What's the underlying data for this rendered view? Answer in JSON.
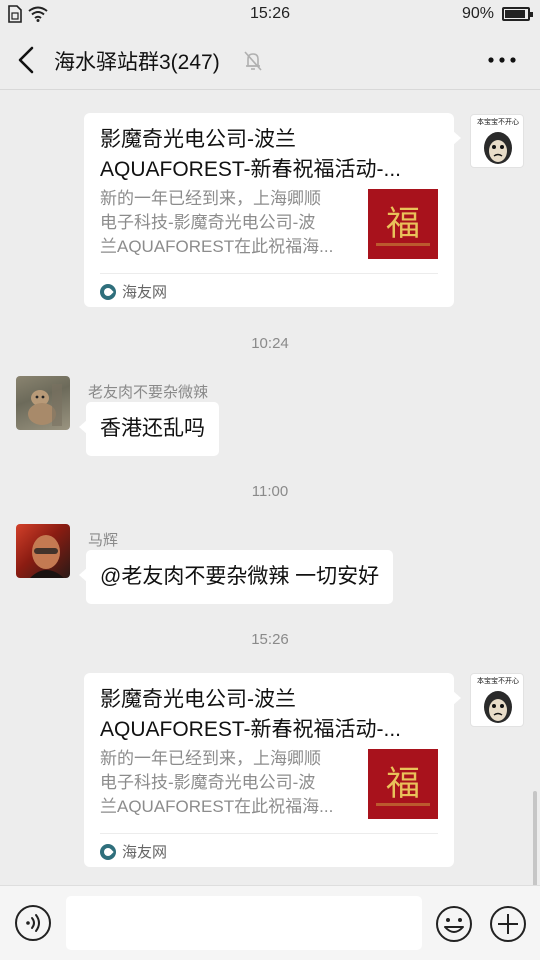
{
  "status_bar": {
    "time": "15:26",
    "battery": "90%"
  },
  "header": {
    "title": "海水驿站群3(247)"
  },
  "messages": {
    "card1": {
      "title": "影魔奇光电公司-波兰\nAQUAFOREST-新春祝福活动-...",
      "desc": "新的一年已经到来，上海卿顺\n电子科技-影魔奇光电公司-波\n兰AQUAFOREST在此祝福海...",
      "source": "海友网",
      "avatar_text": "本宝宝不开心",
      "thumb_text": "福"
    },
    "time1": "10:24",
    "msg1": {
      "sender": "老友肉不要杂微辣",
      "text": "香港还乱吗"
    },
    "time2": "11:00",
    "msg2": {
      "sender": "马辉",
      "text": "@老友肉不要杂微辣  一切安好"
    },
    "time3": "15:26",
    "card2": {
      "title": "影魔奇光电公司-波兰\nAQUAFOREST-新春祝福活动-...",
      "desc": "新的一年已经到来，上海卿顺\n电子科技-影魔奇光电公司-波\n兰AQUAFOREST在此祝福海...",
      "source": "海友网",
      "avatar_text": "本宝宝不开心",
      "thumb_text": "福"
    }
  },
  "input": {
    "placeholder": ""
  },
  "colors": {
    "chat_background": "#ededed",
    "bubble": "#ffffff",
    "thumb_red": "#a8121c",
    "thumb_gold": "#e9c25a"
  }
}
